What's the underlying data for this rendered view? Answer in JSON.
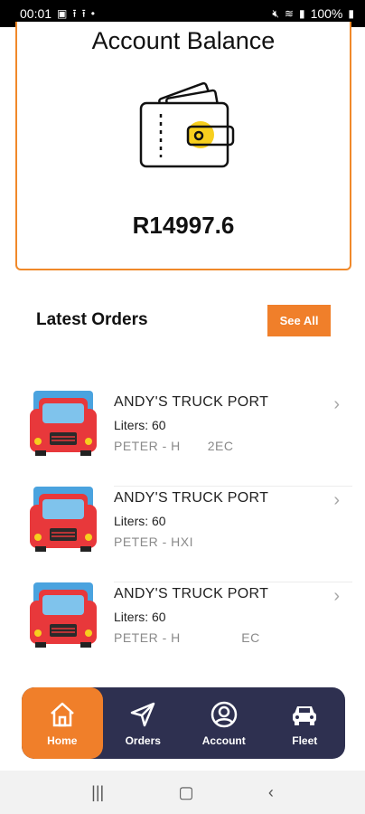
{
  "status_bar": {
    "time": "00:01",
    "battery": "100%"
  },
  "balance": {
    "title": "Account Balance",
    "amount": "R14997.6"
  },
  "latest_orders": {
    "title": "Latest Orders",
    "see_all_label": "See All",
    "items": [
      {
        "station": "ANDY'S TRUCK PORT",
        "liters": "Liters: 60",
        "driver": "PETER - H    2EC"
      },
      {
        "station": "ANDY'S TRUCK PORT",
        "liters": "Liters: 60",
        "driver": "PETER - HXI"
      },
      {
        "station": "ANDY'S TRUCK PORT",
        "liters": "Liters: 60",
        "driver": "PETER - H         EC"
      }
    ]
  },
  "nav": [
    {
      "label": "Home",
      "icon": "home-icon",
      "active": true
    },
    {
      "label": "Orders",
      "icon": "send-icon",
      "active": false
    },
    {
      "label": "Account",
      "icon": "user-circle-icon",
      "active": false
    },
    {
      "label": "Fleet",
      "icon": "car-icon",
      "active": false
    }
  ],
  "colors": {
    "accent": "#f07f2a",
    "nav_bg": "#2e3050",
    "truck_red": "#e8383b",
    "truck_blue": "#4aa3df"
  }
}
